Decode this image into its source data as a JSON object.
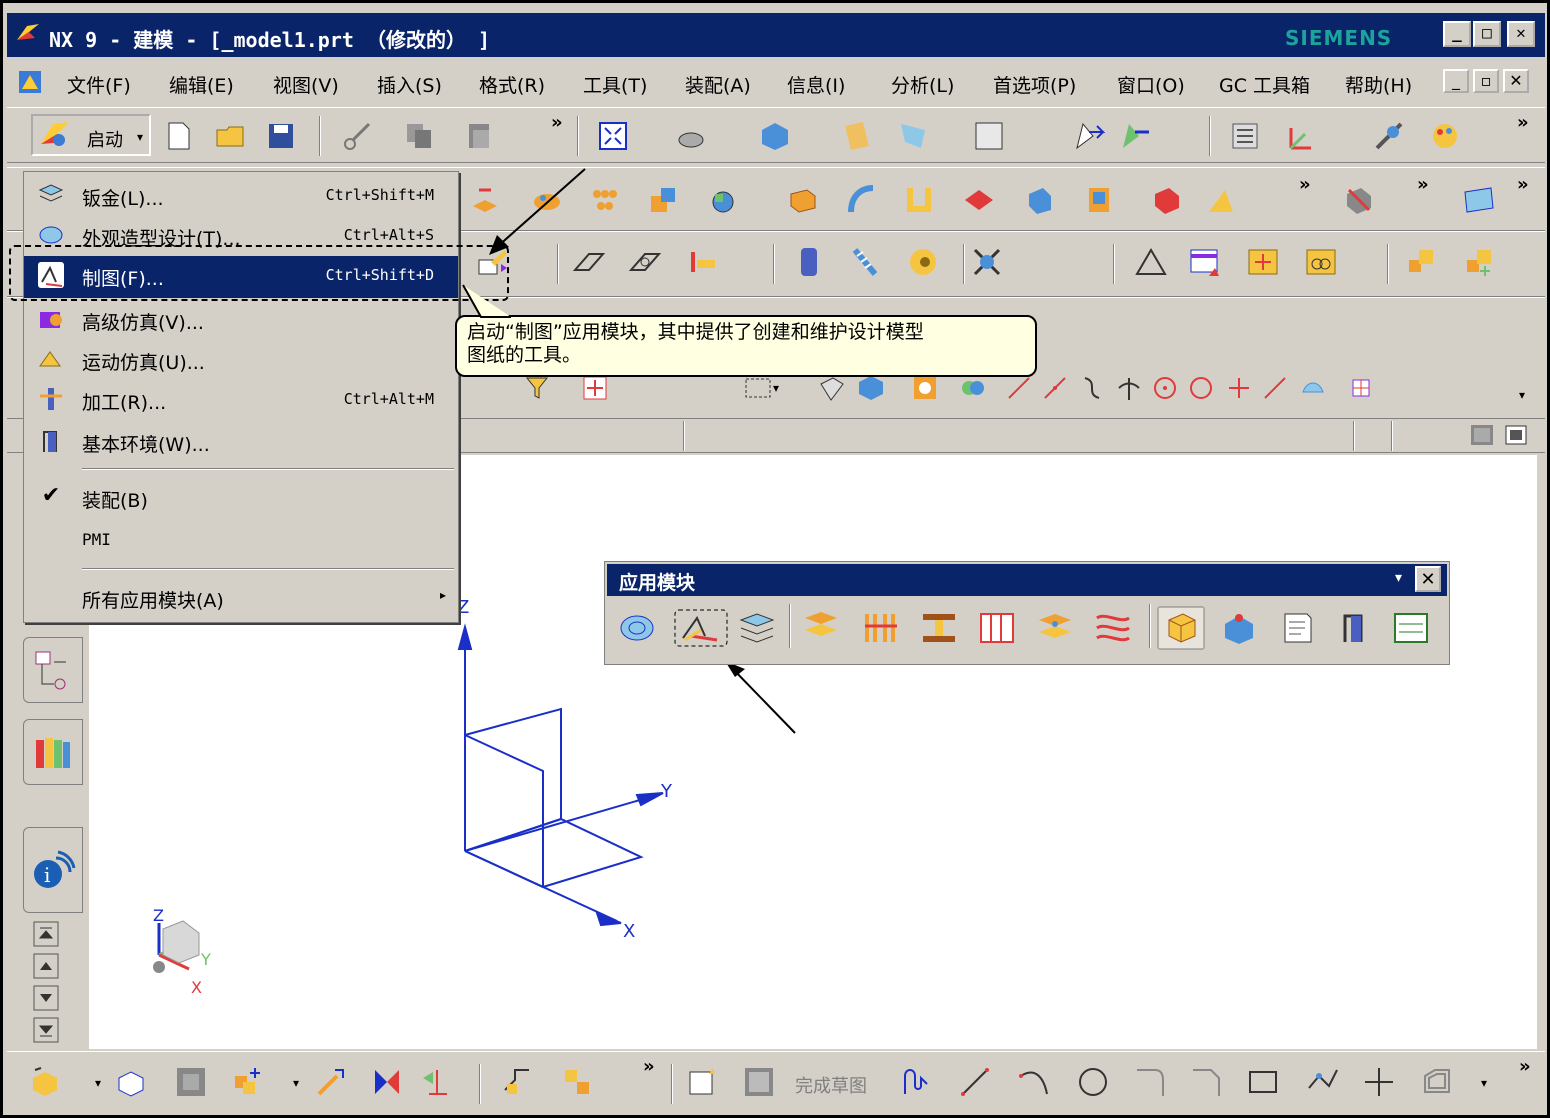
{
  "window": {
    "title": "NX 9 - 建模 - [_model1.prt （修改的） ]",
    "brand": "SIEMENS",
    "controls": [
      "_",
      "□",
      "✕"
    ]
  },
  "menubar": {
    "items": [
      "文件(F)",
      "编辑(E)",
      "视图(V)",
      "插入(S)",
      "格式(R)",
      "工具(T)",
      "装配(A)",
      "信息(I)",
      "分析(L)",
      "首选项(P)",
      "窗口(O)",
      "GC 工具箱",
      "帮助(H)"
    ]
  },
  "toolbar": {
    "start_label": "启动",
    "overflow": "»"
  },
  "start_menu": {
    "items": [
      {
        "label": "钣金(L)...",
        "shortcut": "Ctrl+Shift+M"
      },
      {
        "label": "外观造型设计(T)...",
        "shortcut": "Ctrl+Alt+S"
      },
      {
        "label": "制图(F)...",
        "shortcut": "Ctrl+Shift+D"
      },
      {
        "label": "高级仿真(V)...",
        "shortcut": ""
      },
      {
        "label": "运动仿真(U)...",
        "shortcut": ""
      },
      {
        "label": "加工(R)...",
        "shortcut": "Ctrl+Alt+M"
      },
      {
        "label": "基本环境(W)...",
        "shortcut": ""
      },
      {
        "label": "装配(B)",
        "shortcut": ""
      },
      {
        "label": "PMI",
        "shortcut": ""
      },
      {
        "label": "所有应用模块(A)",
        "shortcut": ""
      }
    ]
  },
  "tooltip": {
    "text_line1": "启动“制图”应用模块，其中提供了创建和维护设计模型",
    "text_line2": "图纸的工具。"
  },
  "palette": {
    "title": "应用模块",
    "close": "✕",
    "dropdown": "▾"
  },
  "axes": {
    "z": "Z",
    "y": "Y",
    "x": "X"
  },
  "bottom_toolbar": {
    "finish_sketch": "完成草图"
  },
  "colors": {
    "title_bg": "#0a246a",
    "face": "#d4d0c8",
    "brand": "#1ba39c",
    "axis": "#1a2fc7",
    "tooltip_bg": "#ffffe1"
  }
}
